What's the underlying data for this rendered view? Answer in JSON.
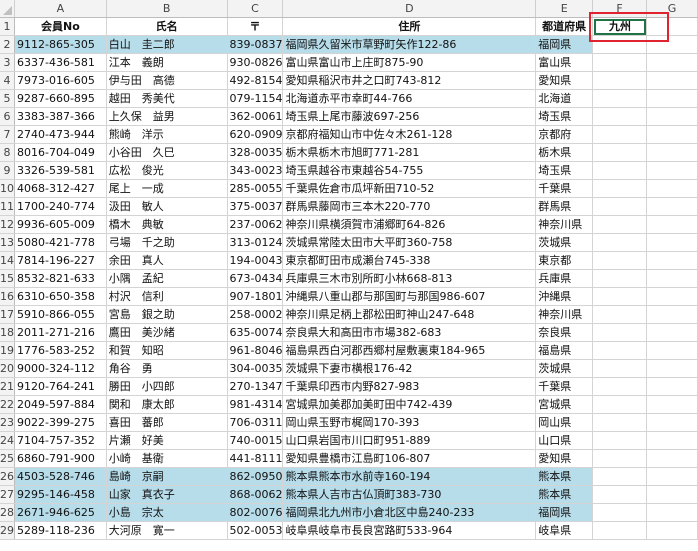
{
  "columns": [
    "A",
    "B",
    "C",
    "D",
    "E",
    "F",
    "G"
  ],
  "header_row": {
    "member_no": "会員No",
    "name": "氏名",
    "postal": "〒",
    "address": "住所",
    "prefecture": "都道府県",
    "filter_value": "九州",
    "filter_button": "▾"
  },
  "rows": [
    {
      "num": "2",
      "id": "9112-865-305",
      "name": "白山　圭二郎",
      "zip": "839-0837",
      "addr": "福岡県久留米市草野町矢作122-86",
      "pref": "福岡県",
      "hl": true
    },
    {
      "num": "3",
      "id": "6337-436-581",
      "name": "江本　義朗",
      "zip": "930-0826",
      "addr": "富山県富山市上庄町875-90",
      "pref": "富山県",
      "hl": false
    },
    {
      "num": "4",
      "id": "7973-016-605",
      "name": "伊与田　高德",
      "zip": "492-8154",
      "addr": "愛知県稲沢市井之口町743-812",
      "pref": "愛知県",
      "hl": false
    },
    {
      "num": "5",
      "id": "9287-660-895",
      "name": "越田　秀美代",
      "zip": "079-1154",
      "addr": "北海道赤平市幸町44-766",
      "pref": "北海道",
      "hl": false
    },
    {
      "num": "6",
      "id": "3383-387-366",
      "name": "上久保　益男",
      "zip": "362-0061",
      "addr": "埼玉県上尾市藤波697-256",
      "pref": "埼玉県",
      "hl": false
    },
    {
      "num": "7",
      "id": "2740-473-944",
      "name": "熊崎　洋示",
      "zip": "620-0909",
      "addr": "京都府福知山市中佐々木261-128",
      "pref": "京都府",
      "hl": false
    },
    {
      "num": "8",
      "id": "8016-704-049",
      "name": "小谷田　久巳",
      "zip": "328-0035",
      "addr": "栃木県栃木市旭町771-281",
      "pref": "栃木県",
      "hl": false
    },
    {
      "num": "9",
      "id": "3326-539-581",
      "name": "広松　俊光",
      "zip": "343-0023",
      "addr": "埼玉県越谷市東越谷54-755",
      "pref": "埼玉県",
      "hl": false
    },
    {
      "num": "10",
      "id": "4068-312-427",
      "name": "尾上　一成",
      "zip": "285-0055",
      "addr": "千葉県佐倉市瓜坪新田710-52",
      "pref": "千葉県",
      "hl": false
    },
    {
      "num": "11",
      "id": "1700-240-774",
      "name": "汲田　敏人",
      "zip": "375-0037",
      "addr": "群馬県藤岡市三本木220-770",
      "pref": "群馬県",
      "hl": false
    },
    {
      "num": "12",
      "id": "9936-605-009",
      "name": "橋木　典敏",
      "zip": "237-0062",
      "addr": "神奈川県横須賀市浦郷町64-826",
      "pref": "神奈川県",
      "hl": false
    },
    {
      "num": "13",
      "id": "5080-421-778",
      "name": "弓場　千之助",
      "zip": "313-0124",
      "addr": "茨城県常陸太田市大平町360-758",
      "pref": "茨城県",
      "hl": false
    },
    {
      "num": "14",
      "id": "7814-196-227",
      "name": "余田　真人",
      "zip": "194-0043",
      "addr": "東京都町田市成瀬台745-338",
      "pref": "東京都",
      "hl": false
    },
    {
      "num": "15",
      "id": "8532-821-633",
      "name": "小隅　孟紀",
      "zip": "673-0434",
      "addr": "兵庫県三木市別所町小林668-813",
      "pref": "兵庫県",
      "hl": false
    },
    {
      "num": "16",
      "id": "6310-650-358",
      "name": "村沢　信利",
      "zip": "907-1801",
      "addr": "沖縄県八重山郡与那国町与那国986-607",
      "pref": "沖縄県",
      "hl": false
    },
    {
      "num": "17",
      "id": "5910-866-055",
      "name": "宮島　銀之助",
      "zip": "258-0002",
      "addr": "神奈川県足柄上郡松田町神山247-648",
      "pref": "神奈川県",
      "hl": false
    },
    {
      "num": "18",
      "id": "2011-271-216",
      "name": "鷹田　美沙緒",
      "zip": "635-0074",
      "addr": "奈良県大和高田市市場382-683",
      "pref": "奈良県",
      "hl": false
    },
    {
      "num": "19",
      "id": "1776-583-252",
      "name": "和賀　知昭",
      "zip": "961-8046",
      "addr": "福島県西白河郡西郷村屋敷裏東184-965",
      "pref": "福島県",
      "hl": false
    },
    {
      "num": "20",
      "id": "9000-324-112",
      "name": "角谷　勇",
      "zip": "304-0035",
      "addr": "茨城県下妻市横根176-42",
      "pref": "茨城県",
      "hl": false
    },
    {
      "num": "21",
      "id": "9120-764-241",
      "name": "勝田　小四郎",
      "zip": "270-1347",
      "addr": "千葉県印西市内野827-983",
      "pref": "千葉県",
      "hl": false
    },
    {
      "num": "22",
      "id": "2049-597-884",
      "name": "関和　康太郎",
      "zip": "981-4314",
      "addr": "宮城県加美郡加美町田中742-439",
      "pref": "宮城県",
      "hl": false
    },
    {
      "num": "23",
      "id": "9022-399-275",
      "name": "喜田　蕃郎",
      "zip": "706-0311",
      "addr": "岡山県玉野市梶岡170-393",
      "pref": "岡山県",
      "hl": false
    },
    {
      "num": "24",
      "id": "7104-757-352",
      "name": "片瀬　好美",
      "zip": "740-0015",
      "addr": "山口県岩国市川口町951-889",
      "pref": "山口県",
      "hl": false
    },
    {
      "num": "25",
      "id": "6860-791-900",
      "name": "小崎　基衛",
      "zip": "441-8111",
      "addr": "愛知県豊橋市江島町106-807",
      "pref": "愛知県",
      "hl": false
    },
    {
      "num": "26",
      "id": "4503-528-746",
      "name": "島崎　京嗣",
      "zip": "862-0950",
      "addr": "熊本県熊本市水前寺160-194",
      "pref": "熊本県",
      "hl": true
    },
    {
      "num": "27",
      "id": "9295-146-458",
      "name": "山家　真衣子",
      "zip": "868-0062",
      "addr": "熊本県人吉市古仏頂町383-730",
      "pref": "熊本県",
      "hl": true
    },
    {
      "num": "28",
      "id": "2671-946-625",
      "name": "小島　宗太",
      "zip": "802-0076",
      "addr": "福岡県北九州市小倉北区中島240-233",
      "pref": "福岡県",
      "hl": true
    },
    {
      "num": "29",
      "id": "5289-118-236",
      "name": "大河原　寛一",
      "zip": "502-0053",
      "addr": "岐阜県岐阜市長良宮路町533-964",
      "pref": "岐阜県",
      "hl": false
    }
  ],
  "colors": {
    "highlight": "#b7dcea",
    "selection_border": "#217346",
    "callout_border": "#e0242f",
    "header_bg": "#f3f3f3"
  }
}
